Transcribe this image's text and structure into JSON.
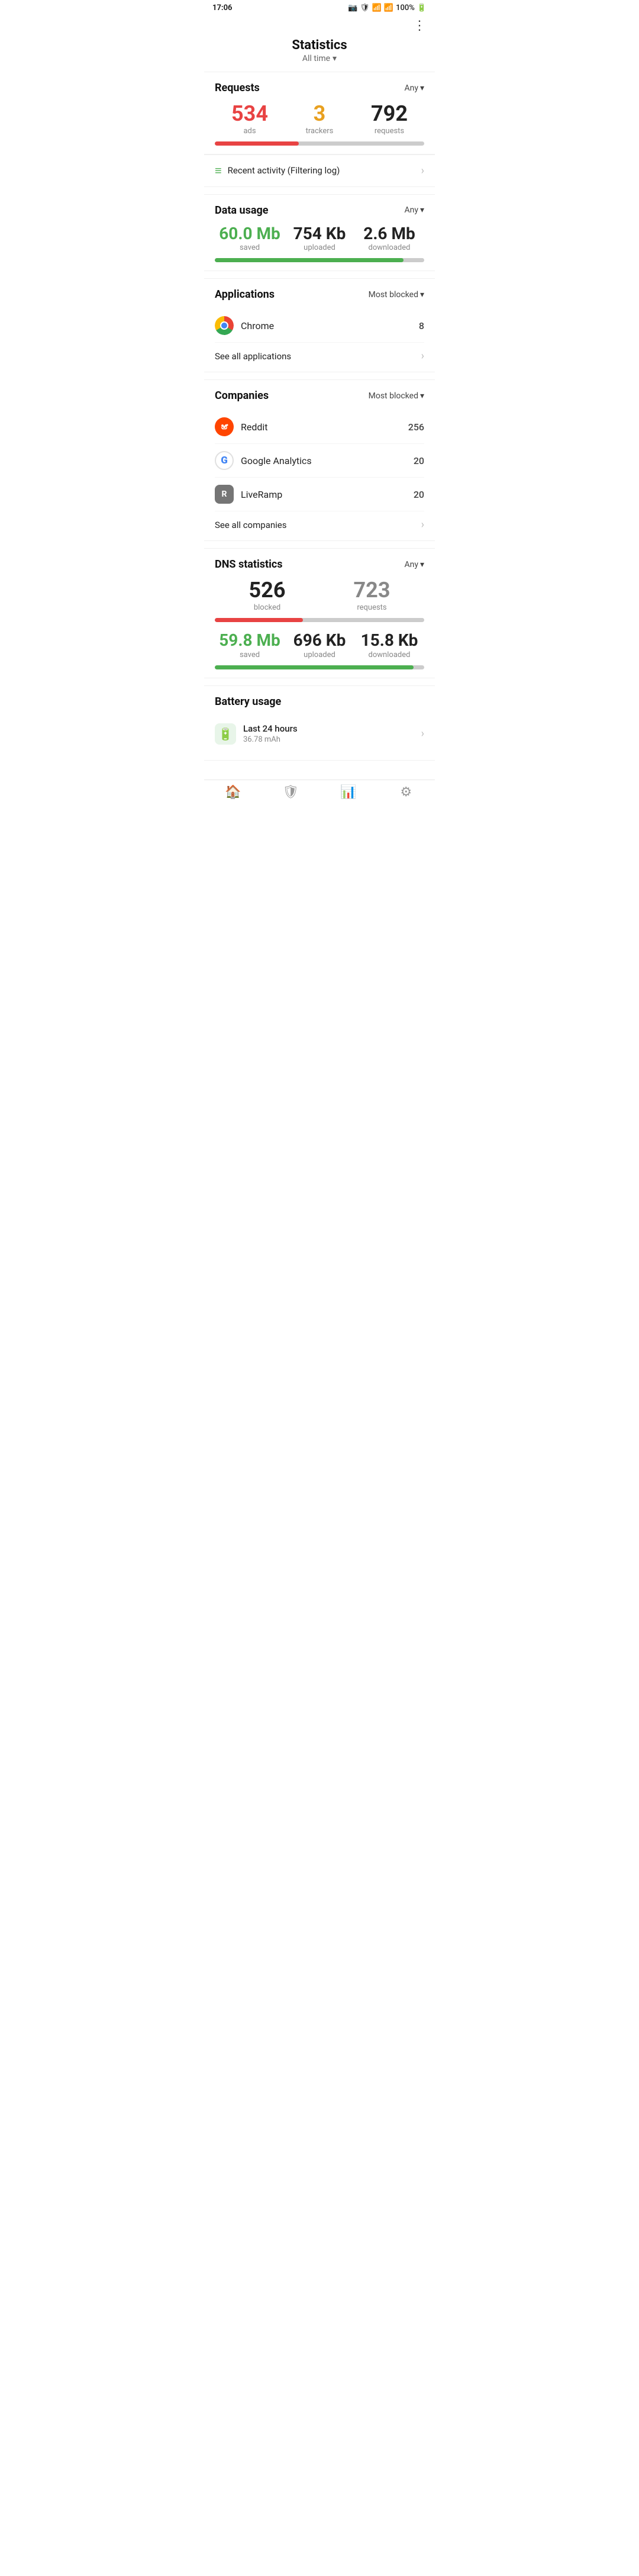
{
  "statusBar": {
    "time": "17:06",
    "batteryPercent": "100%"
  },
  "header": {
    "title": "Statistics",
    "filterLabel": "All time",
    "chevron": "▾"
  },
  "requests": {
    "sectionTitle": "Requests",
    "filterLabel": "Any",
    "adsValue": "534",
    "adsLabel": "ads",
    "trackersValue": "3",
    "trackersLabel": "trackers",
    "requestsValue": "792",
    "requestsLabel": "requests",
    "progressPercent": 40
  },
  "recentActivity": {
    "label": "Recent activity (Filtering log)"
  },
  "dataUsage": {
    "sectionTitle": "Data usage",
    "filterLabel": "Any",
    "savedValue": "60.0 Mb",
    "savedLabel": "saved",
    "uploadedValue": "754 Kb",
    "uploadedLabel": "uploaded",
    "downloadedValue": "2.6 Mb",
    "downloadedLabel": "downloaded",
    "progressPercent": 90
  },
  "applications": {
    "sectionTitle": "Applications",
    "filterLabel": "Most blocked",
    "items": [
      {
        "name": "Chrome",
        "count": "8",
        "icon": "chrome"
      }
    ],
    "seeAllLabel": "See all applications"
  },
  "companies": {
    "sectionTitle": "Companies",
    "filterLabel": "Most blocked",
    "items": [
      {
        "name": "Reddit",
        "count": "256",
        "icon": "reddit"
      },
      {
        "name": "Google Analytics",
        "count": "20",
        "icon": "google"
      },
      {
        "name": "LiveRamp",
        "count": "20",
        "icon": "liveramp"
      }
    ],
    "seeAllLabel": "See all companies"
  },
  "dnsStats": {
    "sectionTitle": "DNS statistics",
    "filterLabel": "Any",
    "blockedValue": "526",
    "blockedLabel": "blocked",
    "requestsValue": "723",
    "requestsLabel": "requests",
    "progressPercent": 42,
    "savedValue": "59.8 Mb",
    "savedLabel": "saved",
    "uploadedValue": "696 Kb",
    "uploadedLabel": "uploaded",
    "downloadedValue": "15.8 Kb",
    "downloadedLabel": "downloaded",
    "progressPercent2": 95
  },
  "battery": {
    "sectionTitle": "Battery usage",
    "rowLabel": "Last 24 hours",
    "rowSubLabel": "36.78 mAh"
  },
  "bottomNav": {
    "items": [
      {
        "icon": "🏠",
        "name": "home"
      },
      {
        "icon": "🛡",
        "name": "protection"
      },
      {
        "icon": "📊",
        "name": "statistics",
        "active": true
      },
      {
        "icon": "⚙",
        "name": "settings"
      }
    ]
  }
}
